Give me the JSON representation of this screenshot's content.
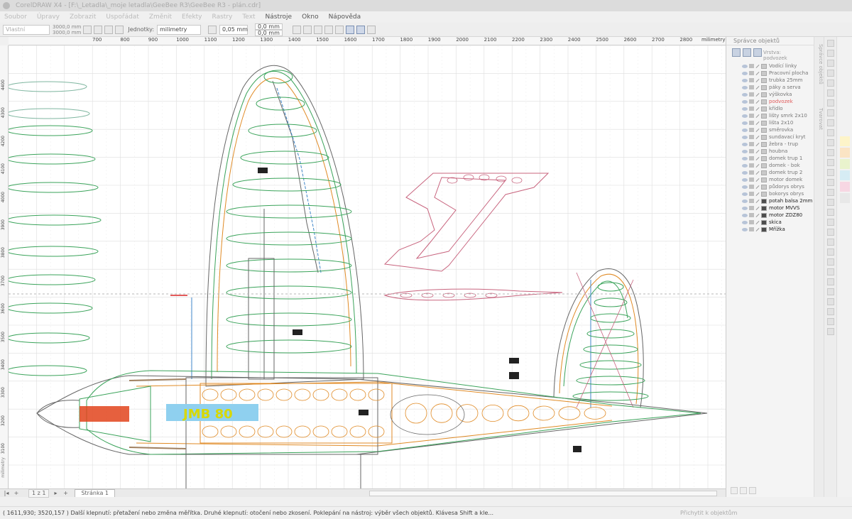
{
  "window": {
    "title": "CorelDRAW X4 - [F:\\_Letadla\\_moje letadla\\GeeBee R3\\GeeBee R3 - plán.cdr]"
  },
  "menu": [
    {
      "label": "Soubor",
      "faded": true
    },
    {
      "label": "Úpravy",
      "faded": true
    },
    {
      "label": "Zobrazit",
      "faded": true
    },
    {
      "label": "Uspořádat",
      "faded": true
    },
    {
      "label": "Změnit",
      "faded": true
    },
    {
      "label": "Efekty",
      "faded": true
    },
    {
      "label": "Rastry",
      "faded": true
    },
    {
      "label": "Text",
      "faded": true
    },
    {
      "label": "Nástroje",
      "faded": false
    },
    {
      "label": "Okno",
      "faded": false
    },
    {
      "label": "Nápověda",
      "faded": false
    }
  ],
  "propbar": {
    "page_size": "Vlastní",
    "width": "3000,0 mm",
    "height": "3000,0 mm",
    "units_label": "Jednotky:",
    "units_value": "milimetry",
    "nudge": "0,05 mm",
    "dup_x": "0,0 mm",
    "dup_y": "0,0 mm"
  },
  "ruler": {
    "h_ticks": [
      "700",
      "800",
      "900",
      "1000",
      "1100",
      "1200",
      "1300",
      "1400",
      "1500",
      "1600",
      "1700",
      "1800",
      "1900",
      "2000",
      "2100",
      "2200",
      "2300",
      "2400",
      "2500",
      "2600",
      "2700",
      "2800"
    ],
    "h_unit": "milimetry",
    "v_ticks": [
      "4400",
      "4300",
      "4200",
      "4100",
      "4000",
      "3900",
      "3800",
      "3700",
      "3600",
      "3500",
      "3400",
      "3300",
      "3200",
      "3100"
    ],
    "v_unit": "milimetry"
  },
  "drawing": {
    "fuselage_label": "JMB 80",
    "colors": {
      "green": "#3aa35a",
      "orange": "#e08a24",
      "blue": "#3f86c8",
      "pink": "#c8647e",
      "gray": "#666666",
      "engine": "#e2441c",
      "label_bg": "#8fd0ef",
      "label_text": "#d8d800"
    }
  },
  "bottombar": {
    "page_count": "1 z 1",
    "page_tab": "Stránka 1"
  },
  "status": {
    "coords": "( 1611,930; 3520,157 )",
    "hint": "Další klepnutí: přetažení nebo změna měřítka. Druhé klepnutí: otočení  nebo zkosení. Poklepání na nástroj: výběr všech objektů. Klávesa Shift a kle...",
    "snap": "Přichytit k objektům"
  },
  "object_manager": {
    "title": "Správce objektů",
    "layer_label": "Vrstva:",
    "layer_value": "podvozek",
    "layers": [
      {
        "name": "Vodící linky",
        "style": "normal"
      },
      {
        "name": "Pracovní plocha",
        "style": "normal"
      },
      {
        "name": "trubka 25mm",
        "style": "normal"
      },
      {
        "name": "páky a serva",
        "style": "normal"
      },
      {
        "name": "výškovka",
        "style": "normal"
      },
      {
        "name": "podvozek",
        "style": "red"
      },
      {
        "name": "křídlo",
        "style": "normal"
      },
      {
        "name": "lišty smrk 2x10",
        "style": "normal"
      },
      {
        "name": "lišta 2x10",
        "style": "normal"
      },
      {
        "name": "směrovka",
        "style": "normal"
      },
      {
        "name": "sundavací kryt",
        "style": "normal"
      },
      {
        "name": "žebra - trup",
        "style": "normal"
      },
      {
        "name": "houbna",
        "style": "normal"
      },
      {
        "name": "domek trup 1",
        "style": "normal"
      },
      {
        "name": "domek - bok",
        "style": "normal"
      },
      {
        "name": "domek trup 2",
        "style": "normal"
      },
      {
        "name": "motor domek",
        "style": "normal"
      },
      {
        "name": "půdorys obrys",
        "style": "normal"
      },
      {
        "name": "bokorys obrys",
        "style": "normal"
      },
      {
        "name": "potah balsa 2mm",
        "style": "dark"
      },
      {
        "name": "motor MVVS",
        "style": "dark"
      },
      {
        "name": "motor ZDZ80",
        "style": "dark"
      },
      {
        "name": "skica",
        "style": "dark"
      },
      {
        "name": "Mřížka",
        "style": "dark"
      }
    ]
  },
  "side_tabs": [
    "Správce objektů",
    "Tvarovat"
  ],
  "palette": [
    "#fdf4c9",
    "#fbe4c4",
    "#e9f3cd",
    "#d6ecf4",
    "#f7d7e3",
    "#e8e8e8"
  ]
}
